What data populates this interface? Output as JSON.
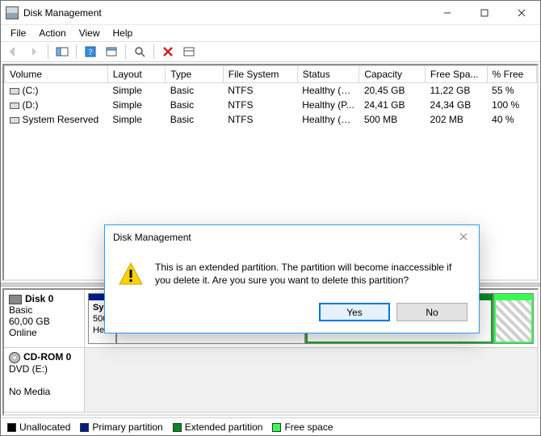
{
  "window": {
    "title": "Disk Management"
  },
  "menu": {
    "file": "File",
    "action": "Action",
    "view": "View",
    "help": "Help"
  },
  "table": {
    "headers": {
      "volume": "Volume",
      "layout": "Layout",
      "type": "Type",
      "filesystem": "File System",
      "status": "Status",
      "capacity": "Capacity",
      "freespace": "Free Spa...",
      "pctfree": "% Free"
    },
    "rows": [
      {
        "volume": "(C:)",
        "layout": "Simple",
        "type": "Basic",
        "fs": "NTFS",
        "status": "Healthy (B...",
        "cap": "20,45 GB",
        "free": "11,22 GB",
        "pct": "55 %"
      },
      {
        "volume": "(D:)",
        "layout": "Simple",
        "type": "Basic",
        "fs": "NTFS",
        "status": "Healthy (P...",
        "cap": "24,41 GB",
        "free": "24,34 GB",
        "pct": "100 %"
      },
      {
        "volume": "System Reserved",
        "layout": "Simple",
        "type": "Basic",
        "fs": "NTFS",
        "status": "Healthy (S...",
        "cap": "500 MB",
        "free": "202 MB",
        "pct": "40 %"
      }
    ]
  },
  "disks": {
    "disk0": {
      "name": "Disk 0",
      "type": "Basic",
      "size": "60,00 GB",
      "state": "Online"
    },
    "part_sys": {
      "title": "Sys",
      "size": "500",
      "status": "Hea"
    },
    "cd": {
      "name": "CD-ROM 0",
      "drive": "DVD (E:)",
      "state": "No Media"
    }
  },
  "legend": {
    "unallocated": "Unallocated",
    "primary": "Primary partition",
    "extended": "Extended partition",
    "free": "Free space"
  },
  "dialog": {
    "title": "Disk Management",
    "message": "This is an extended partition. The partition will become inaccessible if you delete it. Are you sure you want to delete this partition?",
    "yes": "Yes",
    "no": "No"
  }
}
